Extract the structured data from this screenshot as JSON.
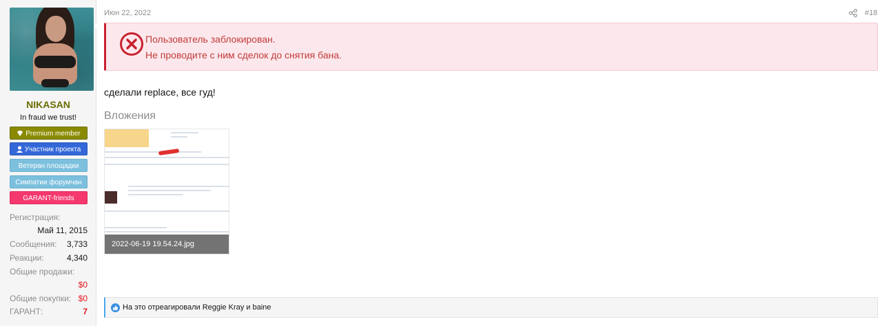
{
  "user": {
    "username": "NIKASAN",
    "title": "In fraud we trust!",
    "banners": [
      {
        "label": "Premium member",
        "icon": "diamond-icon"
      },
      {
        "label": "Участник проекта",
        "icon": "user-icon"
      },
      {
        "label": "Ветеран площадки"
      },
      {
        "label": "Симпатии форумчан"
      },
      {
        "label": "GARANT-friends"
      }
    ],
    "stats": {
      "registration_label": "Регистрация:",
      "registration_value": "Май 11, 2015",
      "messages_label": "Сообщения:",
      "messages_value": "3,733",
      "reactions_label": "Реакции:",
      "reactions_value": "4,340",
      "sales_label": "Общие продажи:",
      "sales_value": "$0",
      "purchases_label": "Общие покупки:",
      "purchases_value": "$0",
      "garant_label": "ГАРАНТ:",
      "garant_value": "7"
    }
  },
  "post": {
    "date": "Июн 22, 2022",
    "number": "#18",
    "ban_notice": {
      "line1": "Пользователь заблокирован.",
      "line2": "Не проводите с ним сделок до снятия бана."
    },
    "message": "сделали replace, все гуд!",
    "attachments_title": "Вложения",
    "attachment": {
      "filename": "2022-06-19 19.54.24.jpg"
    },
    "reactions_text": "На это отреагировали Reggie Kray и baine"
  },
  "colors": {
    "username": "#6b6b00",
    "ban_border": "#c8212e",
    "ban_bg": "#fce8ec",
    "accent_blue": "#47a7eb"
  }
}
